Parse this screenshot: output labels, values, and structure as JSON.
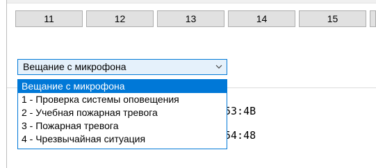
{
  "channels": [
    "11",
    "12",
    "13",
    "14",
    "15"
  ],
  "combo": {
    "selected": "Вещание с микрофона"
  },
  "dropdown": {
    "options": [
      "Вещание с микрофона",
      "1 - Проверка системы оповещения",
      "2 - Учебная пожарная тревога",
      "3 - Пожарная тревога",
      "4 - Чрезвычайная ситуация"
    ],
    "selected_index": 0
  },
  "partial_times": [
    "53:4B",
    "54:48"
  ],
  "colors": {
    "accent": "#0078d7",
    "combo_bg": "#e5f1fb",
    "button_bg": "#e1e1e1"
  }
}
